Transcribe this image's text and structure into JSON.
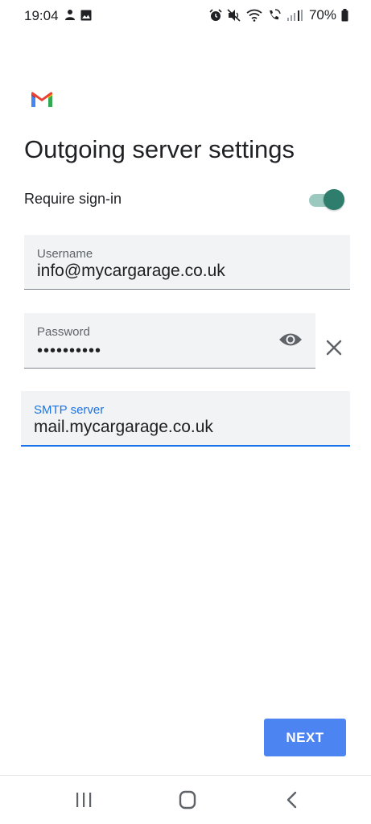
{
  "status_bar": {
    "time": "19:04",
    "battery_text": "70%",
    "left_icons": [
      "person-notification-icon",
      "image-notification-icon"
    ],
    "right_icons": [
      "alarm-icon",
      "mute-icon",
      "wifi-icon",
      "wifi-calling-icon",
      "signal-icon",
      "battery-icon"
    ]
  },
  "app": {
    "logo": "gmail-logo"
  },
  "page": {
    "title": "Outgoing server settings"
  },
  "require_signin": {
    "label": "Require sign-in",
    "enabled": true,
    "accent_color": "#2e7d6d"
  },
  "fields": {
    "username": {
      "label": "Username",
      "value": "info@mycargarage.co.uk"
    },
    "password": {
      "label": "Password",
      "masked_value": "••••••••••"
    },
    "smtp": {
      "label": "SMTP server",
      "value": "mail.mycargarage.co.uk",
      "focused": true,
      "focus_color": "#1a73e8"
    }
  },
  "actions": {
    "next_label": "NEXT",
    "button_color": "#4c84f2"
  },
  "nav": {
    "recents_icon": "recents-icon",
    "home_icon": "home-icon",
    "back_icon": "back-icon"
  }
}
